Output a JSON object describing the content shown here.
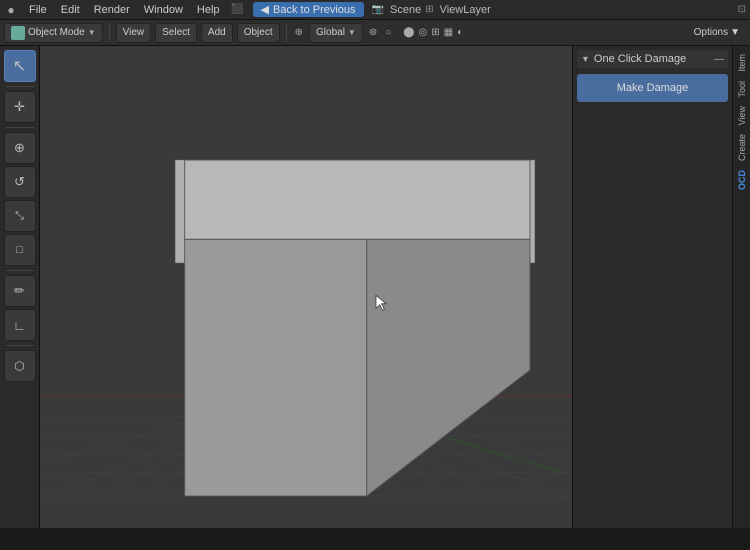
{
  "menu": {
    "blender_icon": "●",
    "items": [
      "File",
      "Edit",
      "Render",
      "Window",
      "Help"
    ],
    "back_to_previous": "Back to Previous",
    "scene": "Scene",
    "view_layer": "ViewLayer"
  },
  "second_toolbar": {
    "object_mode": "Object Mode",
    "view": "View",
    "select": "Select",
    "add": "Add",
    "object": "Object",
    "transform": "Global",
    "options": "Options"
  },
  "left_tools": [
    {
      "icon": "↖",
      "name": "select-tool",
      "active": true
    },
    {
      "icon": "✛",
      "name": "cursor-tool",
      "active": false
    },
    {
      "icon": "⊕",
      "name": "move-tool",
      "active": false
    },
    {
      "icon": "↺",
      "name": "rotate-tool",
      "active": false
    },
    {
      "icon": "⤡",
      "name": "scale-tool",
      "active": false
    },
    {
      "icon": "□",
      "name": "transform-tool",
      "active": false
    },
    {
      "icon": "✏",
      "name": "annotate-tool",
      "active": false
    },
    {
      "icon": "∟",
      "name": "measure-tool",
      "active": false
    },
    {
      "icon": "⬡",
      "name": "add-cube-tool",
      "active": false
    }
  ],
  "panel": {
    "title": "One Click Damage",
    "make_damage_label": "Make Damage",
    "tabs": [
      "Tool",
      "View",
      "Create",
      "Item"
    ]
  },
  "side_tabs": [
    "OCD"
  ],
  "viewport": {
    "grid_color": "#444",
    "bg_color": "#3a3a3a"
  }
}
